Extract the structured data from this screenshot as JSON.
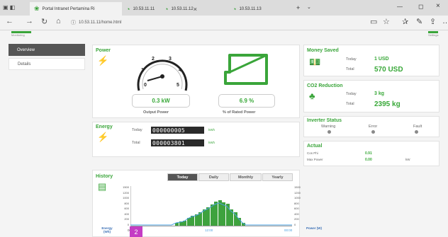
{
  "browser": {
    "tabs": [
      {
        "label": "Portal Intranet Pertamina Ri"
      },
      {
        "label": "10.53.11.11"
      },
      {
        "label": "10.53.11.12"
      },
      {
        "label": "10.53.11.13"
      }
    ],
    "url": "10.53.11.11/home.html"
  },
  "sidebar": {
    "items": [
      {
        "label": "Overview",
        "active": true
      },
      {
        "label": "Details",
        "active": false
      }
    ],
    "logo_text": "Monitoring",
    "right_tag": "Settings"
  },
  "power": {
    "title": "Power",
    "gauge_ticks": [
      "0",
      "1",
      "2",
      "3",
      "4",
      "5"
    ],
    "output_value": "0.3 kW",
    "output_label": "Output Power",
    "rated_value": "6.9 %",
    "rated_label": "% of Rated Power"
  },
  "energy": {
    "title": "Energy",
    "today_label": "Today",
    "today_value": "000000005",
    "today_unit": "kWh",
    "total_label": "Total",
    "total_value": "000003801",
    "total_unit": "kWh"
  },
  "money": {
    "title": "Money Saved",
    "today_label": "Today",
    "today_value": "1 USD",
    "total_label": "Total",
    "total_value": "570 USD"
  },
  "co2": {
    "title": "CO2 Reduction",
    "today_label": "Today",
    "today_value": "3 kg",
    "total_label": "Total",
    "total_value": "2395 kg"
  },
  "inverter": {
    "title": "Inverter Status",
    "warning_label": "Warning",
    "error_label": "Error",
    "fault_label": "Fault"
  },
  "actual": {
    "title": "Actual",
    "cos_label": "Cos Phi",
    "cos_value": "0.91",
    "max_label": "Max Power",
    "max_value": "0.00",
    "max_unit": "kW"
  },
  "history": {
    "title": "History",
    "tabs": [
      "Today",
      "Daily",
      "Monthly",
      "Yearly"
    ],
    "active_tab": "Today",
    "y_left_ticks": [
      "1500",
      "1200",
      "1000",
      "800",
      "600",
      "400",
      "200",
      "0"
    ],
    "y_right_ticks": [
      "1500",
      "1200",
      "1000",
      "800",
      "600",
      "400",
      "200",
      "0"
    ],
    "x_ticks": [
      "00:00",
      "12:00",
      "00:00"
    ],
    "left_axis_label": "Energy (Wh)",
    "right_axis_label": "Power (W)",
    "badge": "2"
  },
  "chart_data": {
    "type": "bar",
    "bars": [
      120,
      150,
      180,
      300,
      380,
      420,
      500,
      620,
      700,
      800,
      900,
      960,
      880,
      820,
      620,
      500,
      300,
      120
    ],
    "ylim": [
      0,
      1500
    ]
  },
  "colors": {
    "accent": "#3aa53a",
    "lcd": "#2a2a2a",
    "badge": "#c43cc4"
  }
}
